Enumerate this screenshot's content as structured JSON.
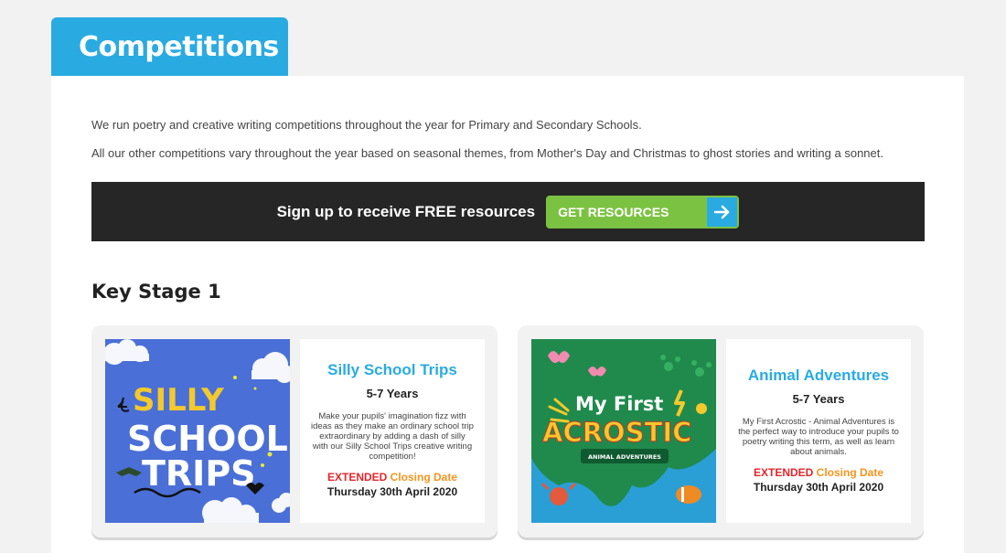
{
  "header": {
    "title": "Competitions"
  },
  "intro": {
    "p1": "We run poetry and creative writing competitions throughout the year for Primary and Secondary Schools.",
    "p2": "All our other competitions vary throughout the year based on seasonal themes, from Mother's Day and Christmas to ghost stories and writing a sonnet."
  },
  "banner": {
    "text": "Sign up to receive FREE resources",
    "button_label": "GET RESOURCES",
    "arrow_icon": "arrow-right-icon"
  },
  "section": {
    "title": "Key Stage 1"
  },
  "cards": [
    {
      "image_text": [
        "SILLY",
        "SCHOOL",
        "TRIPS"
      ],
      "title": "Silly School Trips",
      "age": "5-7 Years",
      "description": "Make your pupils' imagination fizz with ideas as they make an ordinary school trip extraordinary by adding a dash of silly with our Silly School Trips creative writing competition!",
      "status_extended": "EXTENDED",
      "status_closing": "Closing Date",
      "date": "Thursday 30th April 2020"
    },
    {
      "image_text": [
        "My First",
        "ACROSTIC",
        "ANIMAL ADVENTURES"
      ],
      "title": "Animal Adventures",
      "age": "5-7 Years",
      "description": "My First Acrostic - Animal Adventures is the perfect way to introduce your pupils to poetry writing this term, as well as learn about animals.",
      "status_extended": "EXTENDED",
      "status_closing": "Closing Date",
      "date": "Thursday 30th April 2020"
    }
  ],
  "colors": {
    "accent": "#29abe2",
    "green": "#7cc242",
    "red": "#e3262b",
    "orange": "#f7941d",
    "dark": "#262626"
  }
}
